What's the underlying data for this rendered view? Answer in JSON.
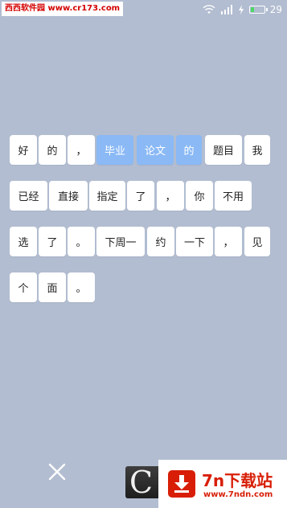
{
  "watermark_top": "西西软件园 www.cr173.com",
  "status_bar": {
    "battery_level": "29",
    "battery_fill_fraction": 0.29,
    "icons": [
      "wifi-icon",
      "signal-icon",
      "charging-bolt-icon",
      "battery-icon"
    ]
  },
  "word_rows": [
    [
      {
        "text": "好",
        "selected": false
      },
      {
        "text": "的",
        "selected": false
      },
      {
        "text": "，",
        "selected": false
      },
      {
        "text": "毕业",
        "selected": true
      },
      {
        "text": "论文",
        "selected": true
      },
      {
        "text": "的",
        "selected": true
      },
      {
        "text": "题目",
        "selected": false
      },
      {
        "text": "我",
        "selected": false
      }
    ],
    [
      {
        "text": "已经",
        "selected": false
      },
      {
        "text": "直接",
        "selected": false
      },
      {
        "text": "指定",
        "selected": false
      },
      {
        "text": "了",
        "selected": false
      },
      {
        "text": "，",
        "selected": false
      },
      {
        "text": "你",
        "selected": false
      },
      {
        "text": "不用",
        "selected": false
      }
    ],
    [
      {
        "text": "选",
        "selected": false
      },
      {
        "text": "了",
        "selected": false
      },
      {
        "text": "。",
        "selected": false
      },
      {
        "text": "下周一",
        "selected": false
      },
      {
        "text": "约",
        "selected": false
      },
      {
        "text": "一下",
        "selected": false
      },
      {
        "text": "，",
        "selected": false
      },
      {
        "text": "见",
        "selected": false
      }
    ],
    [
      {
        "text": "个",
        "selected": false
      },
      {
        "text": "面",
        "selected": false
      },
      {
        "text": "。",
        "selected": false
      }
    ]
  ],
  "colors": {
    "background": "#b2bdd1",
    "chip": "#ffffff",
    "chip_selected": "#8ab9f5",
    "chip_text": "#222222",
    "chip_selected_text": "#ffffff",
    "brand_red": "#d81e06"
  },
  "bottom_bar": {
    "close_icon": "close-icon",
    "widget_glyph": "C",
    "site_logo_name": "7n下载站",
    "site_logo_url": "www.7ndn.com"
  }
}
